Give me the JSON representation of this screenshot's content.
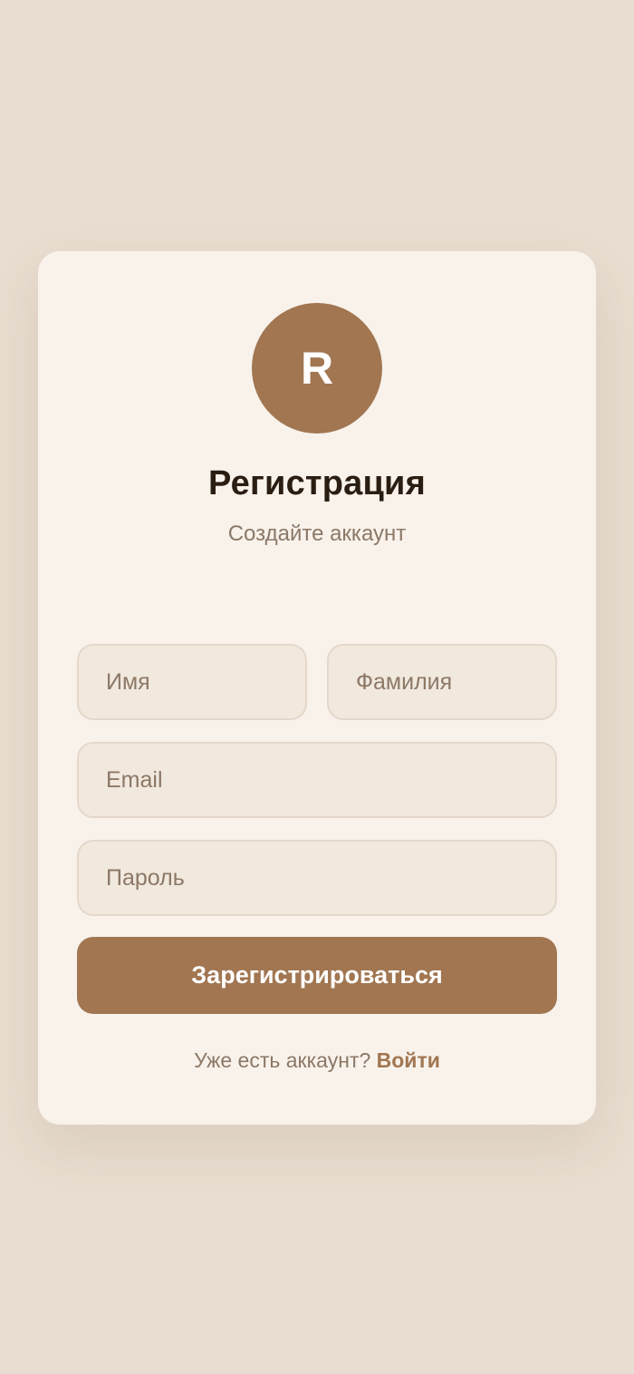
{
  "brand": {
    "logo_letter": "R",
    "accent_color": "#a17651"
  },
  "header": {
    "title": "Регистрация",
    "subtitle": "Создайте аккаунт"
  },
  "form": {
    "first_name_placeholder": "Имя",
    "last_name_placeholder": "Фамилия",
    "email_placeholder": "Email",
    "password_placeholder": "Пароль",
    "submit_label": "Зарегистрироваться"
  },
  "footer": {
    "prompt": "Уже есть аккаунт?",
    "login_link": "Войти"
  }
}
